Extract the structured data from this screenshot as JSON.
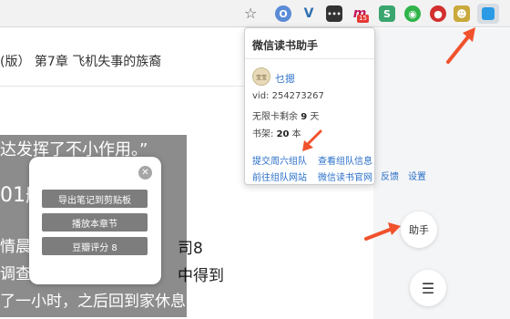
{
  "reader": {
    "title": "(版） 第7章 飞机失事的族裔",
    "quote": "达发挥了不小作用。”",
    "big_number": "01航",
    "lines": [
      "情晨6",
      "调查员",
      "了一小时，之后回到家休息"
    ],
    "right_fragments": [
      "司8",
      "中得到"
    ]
  },
  "context_menu": {
    "close_symbol": "✕",
    "items": [
      "导出笔记到剪贴板",
      "播放本章节",
      "豆瓣评分 8"
    ]
  },
  "extension_popup": {
    "title": "微信读书助手",
    "avatar_text": "宝宝",
    "username": "乜摁",
    "vid_label": "vid: 254273267",
    "card_prefix": "无限卡剩余",
    "card_days": "9",
    "card_suffix": "天",
    "shelf_prefix": "书架:",
    "shelf_count": "20",
    "shelf_suffix": "本",
    "links": [
      "提交周六组队",
      "查看组队信息",
      "前往组队网站",
      "微信读书官网",
      "反馈",
      "设置"
    ]
  },
  "toolbar": {
    "badge": "15",
    "extensions": [
      {
        "name": "opera-icon",
        "color": "#5b8bd6",
        "glyph": "O"
      },
      {
        "name": "v-icon",
        "color": "#2f6fb0",
        "glyph": "V"
      },
      {
        "name": "dots-icon",
        "color": "#333333",
        "glyph": "•••"
      },
      {
        "name": "m-icon",
        "color": "#c2185b",
        "glyph": "m"
      },
      {
        "name": "s-icon",
        "color": "#3aa56f",
        "glyph": "S"
      },
      {
        "name": "chat-icon",
        "color": "#2fb34a",
        "glyph": "◉"
      },
      {
        "name": "record-icon",
        "color": "#d32f2f",
        "glyph": "●"
      },
      {
        "name": "monkey-icon",
        "color": "#8a6d1f",
        "glyph": "☻"
      }
    ]
  },
  "fab": {
    "helper_label": "助手",
    "menu_symbol": "☰"
  },
  "colors": {
    "arrow": "#f0522d",
    "link": "#2a6fc9"
  }
}
